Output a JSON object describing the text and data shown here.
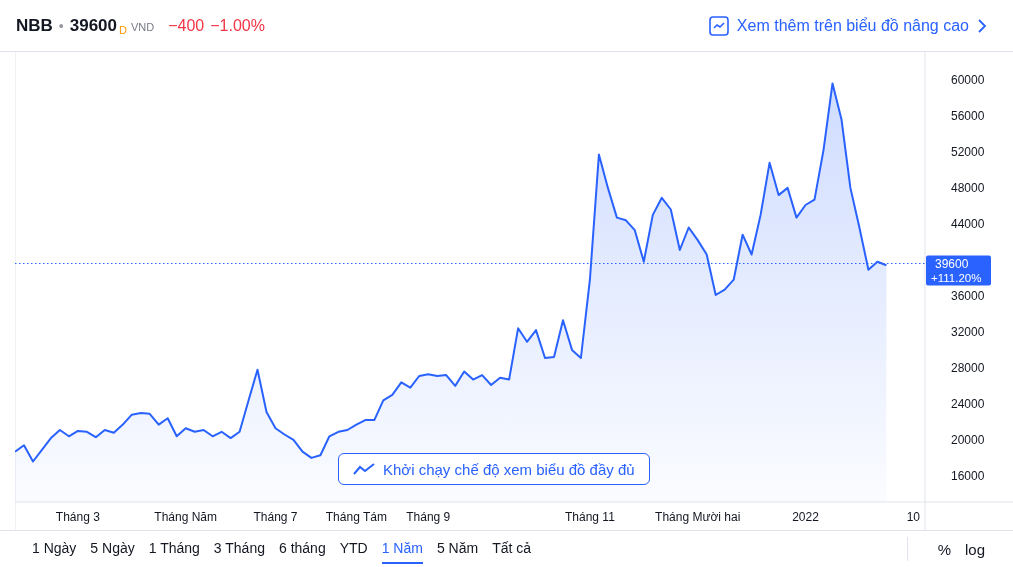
{
  "header": {
    "symbol": "NBB",
    "separator": "•",
    "price": "39600",
    "price_mark": "D",
    "currency": "VND",
    "change": "−400",
    "change_percent": "−1.00%",
    "advanced_link": "Xem thêm trên biểu đồ nâng cao"
  },
  "chart": {
    "overlay_button": "Khởi chạy chế độ xem biểu đồ đầy đủ",
    "price_badge": {
      "change": "+111.20%"
    },
    "chart_data": {
      "type": "area",
      "ylim": [
        13100,
        63100
      ],
      "categories": [
        null,
        null,
        null,
        null,
        null,
        null,
        null,
        "Tháng 3",
        null,
        null,
        null,
        null,
        null,
        null,
        null,
        null,
        null,
        null,
        null,
        "Tháng Năm",
        null,
        null,
        null,
        null,
        null,
        null,
        null,
        null,
        null,
        "Tháng 7",
        null,
        null,
        null,
        null,
        null,
        null,
        null,
        null,
        "Tháng Tám",
        null,
        null,
        null,
        null,
        null,
        null,
        null,
        "Tháng 9",
        null,
        null,
        null,
        null,
        null,
        null,
        null,
        null,
        null,
        null,
        null,
        null,
        null,
        null,
        null,
        null,
        null,
        "Tháng 11",
        null,
        null,
        null,
        null,
        null,
        null,
        null,
        null,
        null,
        null,
        null,
        "Tháng Mười hai",
        null,
        null,
        null,
        null,
        null,
        null,
        null,
        null,
        null,
        null,
        null,
        "2022",
        null,
        null,
        null,
        null,
        null,
        null,
        null,
        null,
        null,
        null,
        null,
        "10",
        null
      ],
      "series": [
        {
          "color": "#2962ff",
          "values": [
            18700,
            19400,
            17600,
            18900,
            20200,
            21100,
            20400,
            21000,
            20900,
            20300,
            21100,
            20800,
            21700,
            22800,
            23000,
            22900,
            21700,
            22400,
            20400,
            21300,
            20900,
            21100,
            20400,
            20900,
            20200,
            20900,
            24400,
            27800,
            23100,
            21300,
            20600,
            20000,
            18700,
            18000,
            18300,
            20400,
            20900,
            21100,
            21700,
            22200,
            22200,
            24400,
            25000,
            26400,
            25800,
            27100,
            27300,
            27100,
            27200,
            26000,
            27600,
            26700,
            27200,
            26100,
            26900,
            26700,
            32400,
            30900,
            32200,
            29100,
            29200,
            33300,
            30000,
            29100,
            37800,
            51700,
            48000,
            44700,
            44400,
            43300,
            39800,
            45000,
            46900,
            45600,
            41100,
            43600,
            42200,
            40600,
            36100,
            36700,
            37800,
            42800,
            40600,
            45000,
            50800,
            47200,
            48000,
            44700,
            46100,
            46700,
            52200,
            59600,
            55600,
            48000,
            43600,
            38900,
            39800,
            39400,
            null,
            null,
            null,
            null
          ]
        }
      ],
      "yticks": [
        16000,
        20000,
        24000,
        28000,
        32000,
        36000,
        44000,
        48000,
        52000,
        56000,
        60000
      ],
      "ref_lines": [
        {
          "axis": "y",
          "value": 39600,
          "label": "39600"
        }
      ]
    }
  },
  "ranges": [
    {
      "label": "1 Ngày",
      "selected": false
    },
    {
      "label": "5 Ngày",
      "selected": false
    },
    {
      "label": "1 Tháng",
      "selected": false
    },
    {
      "label": "3 Tháng",
      "selected": false
    },
    {
      "label": "6 tháng",
      "selected": false
    },
    {
      "label": "YTD",
      "selected": false
    },
    {
      "label": "1 Năm",
      "selected": true
    },
    {
      "label": "5 Năm",
      "selected": false
    },
    {
      "label": "Tất cả",
      "selected": false
    }
  ],
  "scale_options": [
    "%",
    "log"
  ]
}
